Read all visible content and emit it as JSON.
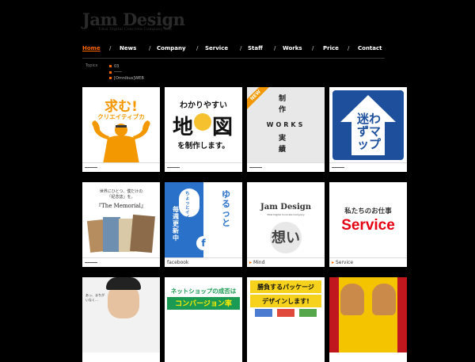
{
  "logo": {
    "title": "Jam Design",
    "tagline": "Total Digital Concrete Company Site"
  },
  "nav": {
    "items": [
      "Home",
      "News",
      "Company",
      "Service",
      "Staff",
      "Works",
      "Price",
      "Contact"
    ],
    "active": "Home",
    "separator": "/"
  },
  "topics": {
    "label": "Topics",
    "items": [
      "03",
      "――",
      "[Omnibus]WEB"
    ]
  },
  "tiles": {
    "t1": {
      "text1": "求む!",
      "text2": "クリエイティブカ",
      "caption": ""
    },
    "t2": {
      "text1": "わかりやすい",
      "text2a": "地",
      "text2b": "図",
      "text3": "を制作します。",
      "caption": ""
    },
    "t3": {
      "badge": "NEW",
      "text1": "制作",
      "text2": "WORKS",
      "text3": "実績",
      "caption": ""
    },
    "t4": {
      "text": "迷わずマップ",
      "caption": ""
    },
    "t5": {
      "text1": "世界にひとつ、僕だけの",
      "text2": "「紀念誌」を。",
      "text3": "『The Memorial』",
      "caption": ""
    },
    "t6": {
      "text1": "ちょっとイイ話",
      "text2": "毎週更新中",
      "text3": "ゆるっと",
      "caption": "facebook"
    },
    "t7": {
      "text1": "Jam Design",
      "text2": "Total Digital Concrete Company",
      "text3": "想い",
      "caption": "Mind"
    },
    "t8": {
      "text1": "私たちのお仕事",
      "text2": "Service",
      "caption": "Service"
    },
    "t9": {
      "text": "あっ、まちがいなく…",
      "caption": ""
    },
    "t10": {
      "text1": "ネットショップの成否は",
      "text2": "コンバージョン率",
      "caption": ""
    },
    "t11": {
      "text1": "勝負するパッケージ",
      "text2": "デザインします!",
      "caption": ""
    },
    "t12": {
      "text": "",
      "caption": ""
    }
  },
  "colors": {
    "accent": "#ff6600",
    "tile1_bg": "#ffffff",
    "tile1_orange": "#f39800",
    "tile3_bg": "#e8e8e8",
    "tile4_blue": "#1d4f9c",
    "tile6_blue": "#2a72c9",
    "tile8_red": "#e60012"
  }
}
